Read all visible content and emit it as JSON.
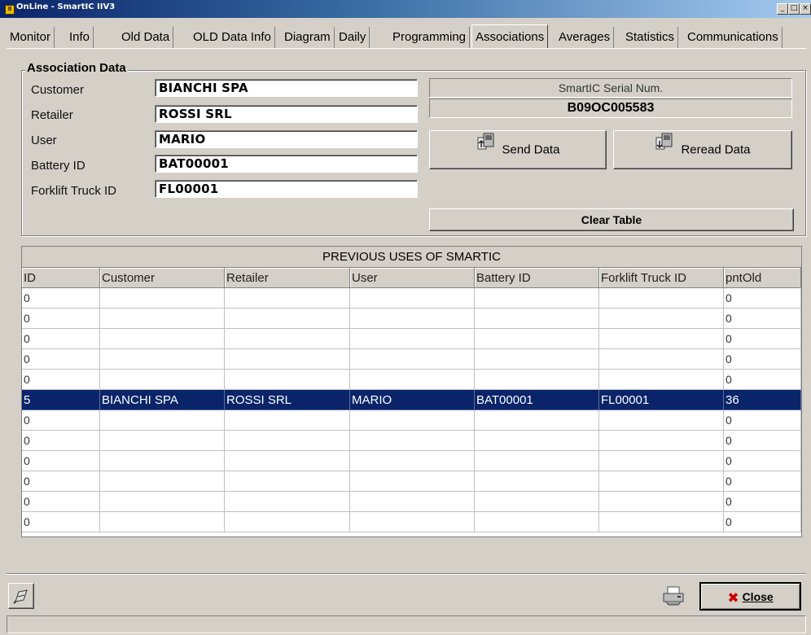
{
  "window": {
    "title": "OnLine - SmartIC IIV3"
  },
  "title_buttons": {
    "minimize": "_",
    "maximize": "□",
    "close": "×"
  },
  "tabs": [
    "Monitor",
    "Info",
    "Old Data",
    "OLD Data Info",
    "Diagram",
    "Daily",
    "Programming",
    "Associations",
    "Averages",
    "Statistics",
    "Communications"
  ],
  "active_tab": "Associations",
  "association": {
    "group_title": "Association Data",
    "labels": {
      "customer": "Customer",
      "retailer": "Retailer",
      "user": "User",
      "battery": "Battery ID",
      "forklift": "Forklift Truck ID"
    },
    "values": {
      "customer": "BIANCHI SPA",
      "retailer": "ROSSI SRL",
      "user": "MARIO",
      "battery": "BAT00001",
      "forklift": "FL00001"
    }
  },
  "serial": {
    "label": "SmartIC Serial Num.",
    "value": "B09OC005583"
  },
  "buttons": {
    "send": "Send Data",
    "reread": "Reread Data",
    "clear": "Clear Table",
    "close": "Close"
  },
  "table": {
    "caption": "PREVIOUS USES OF SMARTIC",
    "columns": [
      "ID",
      "Customer",
      "Retailer",
      "User",
      "Battery ID",
      "Forklift Truck ID",
      "pntOld"
    ],
    "rows": [
      [
        "0",
        "",
        "",
        "",
        "",
        "",
        "0"
      ],
      [
        "0",
        "",
        "",
        "",
        "",
        "",
        "0"
      ],
      [
        "0",
        "",
        "",
        "",
        "",
        "",
        "0"
      ],
      [
        "0",
        "",
        "",
        "",
        "",
        "",
        "0"
      ],
      [
        "0",
        "",
        "",
        "",
        "",
        "",
        "0"
      ],
      [
        "5",
        "BIANCHI SPA",
        "ROSSI SRL",
        "MARIO",
        "BAT00001",
        "FL00001",
        "36"
      ],
      [
        "0",
        "",
        "",
        "",
        "",
        "",
        "0"
      ],
      [
        "0",
        "",
        "",
        "",
        "",
        "",
        "0"
      ],
      [
        "0",
        "",
        "",
        "",
        "",
        "",
        "0"
      ],
      [
        "0",
        "",
        "",
        "",
        "",
        "",
        "0"
      ],
      [
        "0",
        "",
        "",
        "",
        "",
        "",
        "0"
      ],
      [
        "0",
        "",
        "",
        "",
        "",
        "",
        "0"
      ]
    ],
    "selected_row": 5
  },
  "colors": {
    "selection": "#0a246a",
    "face": "#d4d0c8",
    "close_x": "#cc0000"
  },
  "icons": {
    "bottom_left": "serial-cable-icon",
    "printer": "printer-icon",
    "send": "chip-upload-icon",
    "reread": "chip-download-icon",
    "close": "red-x-icon"
  }
}
